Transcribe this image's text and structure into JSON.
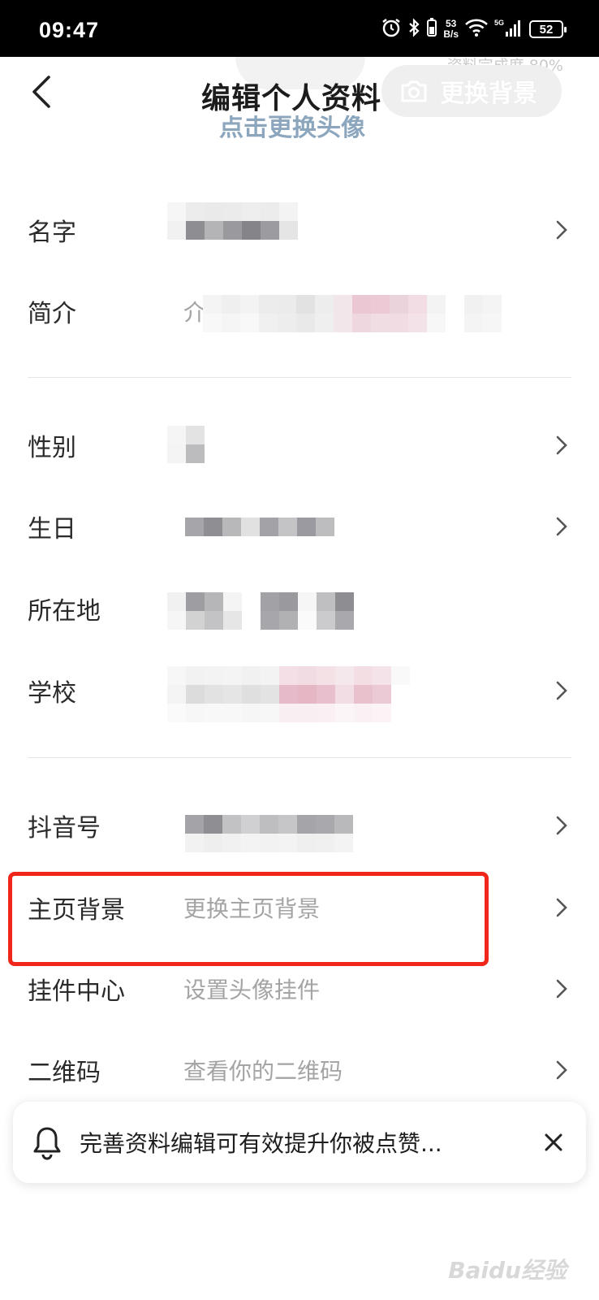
{
  "status_bar": {
    "time": "09:47",
    "net_speed_value": "53",
    "net_speed_unit": "B/s",
    "network_type": "5G",
    "battery": "52"
  },
  "header": {
    "title": "编辑个人资料",
    "change_background_label": "更换背景",
    "completion_text": "资料完成度 80%",
    "change_avatar_text": "点击更换头像"
  },
  "rows": {
    "name": {
      "label": "名字"
    },
    "bio": {
      "label": "简介",
      "value_prefix": "介"
    },
    "gender": {
      "label": "性别"
    },
    "birthday": {
      "label": "生日"
    },
    "location": {
      "label": "所在地"
    },
    "school": {
      "label": "学校"
    },
    "douyin_id": {
      "label": "抖音号"
    },
    "home_background": {
      "label": "主页背景",
      "value": "更换主页背景"
    },
    "pendant_center": {
      "label": "挂件中心",
      "value": "设置头像挂件"
    },
    "qr_code": {
      "label": "二维码",
      "value": "查看你的二维码"
    }
  },
  "tip": {
    "text": "完善资料编辑可有效提升你被点赞..."
  },
  "watermark": "Baidu经验",
  "colors": {
    "highlight": "#f0261b",
    "label": "#2a2a2a",
    "secondary": "#a4a4a4"
  }
}
